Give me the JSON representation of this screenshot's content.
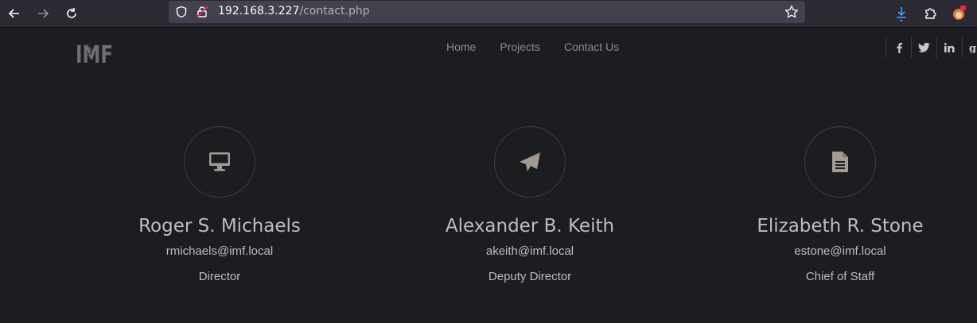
{
  "browser": {
    "url_host": "192.168.3.227",
    "url_path": "/contact.php"
  },
  "site": {
    "logo_text": "IMF",
    "nav": [
      "Home",
      "Projects",
      "Contact Us"
    ],
    "social": [
      "f",
      "t",
      "in",
      "g+"
    ]
  },
  "contacts": [
    {
      "name": "Roger S. Michaels",
      "email": "rmichaels@imf.local",
      "role": "Director",
      "icon": "desktop-icon"
    },
    {
      "name": "Alexander B. Keith",
      "email": "akeith@imf.local",
      "role": "Deputy Director",
      "icon": "paper-plane-icon"
    },
    {
      "name": "Elizabeth R. Stone",
      "email": "estone@imf.local",
      "role": "Chief of Staff",
      "icon": "document-icon"
    }
  ],
  "colors": {
    "page_bg": "#1c1d20",
    "toolbar_bg": "#2b2a33",
    "urlbar_bg": "#42414d",
    "text": "#bdbdc0",
    "icon": "#a39b93"
  }
}
